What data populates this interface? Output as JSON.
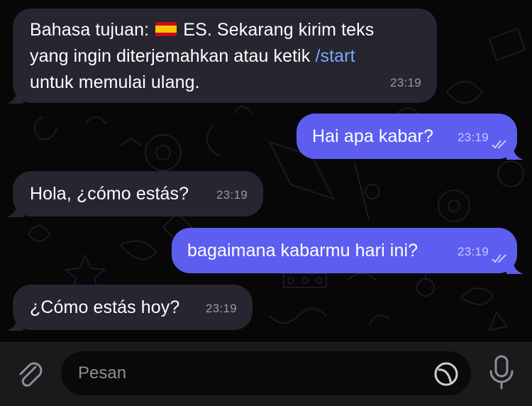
{
  "messages": [
    {
      "direction": "incoming",
      "text_before_flag": "Bahasa tujuan: ",
      "flag": "🇪🇸",
      "text_after_flag": " ES. Sekarang kirim teks",
      "line2_text": "yang ingin diterjemahkan atau ketik ",
      "link": "/start",
      "line3_text": "untuk memulai ulang.",
      "time": "23:19"
    },
    {
      "direction": "outgoing",
      "text": "Hai apa kabar?",
      "time": "23:19",
      "status_icon": "double-check-icon"
    },
    {
      "direction": "incoming",
      "text": "Hola, ¿cómo estás?",
      "time": "23:19"
    },
    {
      "direction": "outgoing",
      "text": "bagaimana kabarmu hari ini?",
      "time": "23:19",
      "status_icon": "double-check-icon"
    },
    {
      "direction": "incoming",
      "text": "¿Cómo estás hoy?",
      "time": "23:19"
    }
  ],
  "input": {
    "placeholder": "Pesan",
    "attach_icon": "paperclip-icon",
    "sticker_icon": "sticker-icon",
    "mic_icon": "microphone-icon"
  },
  "colors": {
    "incoming_bubble": "#262530",
    "outgoing_bubble": "#5d5ef0",
    "link": "#7ea6ff",
    "chat_background": "#070708"
  }
}
